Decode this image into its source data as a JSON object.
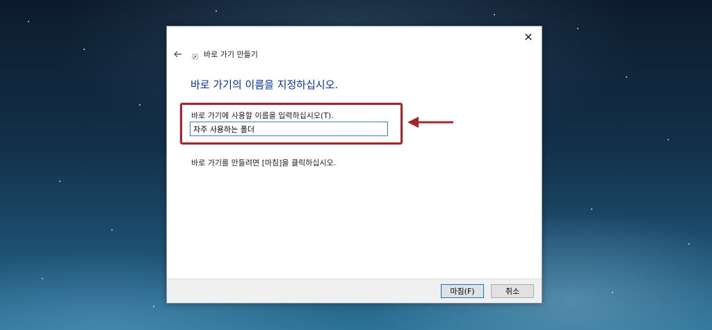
{
  "dialog": {
    "close_glyph": "✕",
    "nav_title": "바로 가기 만들기",
    "heading": "바로 가기의 이름을 지정하십시오.",
    "field_label": "바로 가기에 사용할 이름을 입력하십시오(T).",
    "name_value": "자주 사용하는 폴더",
    "instruction": "바로 가기를 만들려면 [마침]을 클릭하십시오.",
    "finish_label": "마침(F)",
    "cancel_label": "취소"
  },
  "icons": {
    "back": "back-arrow-icon",
    "close": "close-icon",
    "shortcut": "shortcut-icon",
    "annotation": "red-arrow-icon"
  },
  "colors": {
    "heading": "#003399",
    "highlight": "#a4262c",
    "input_border": "#3c7fb1",
    "finish_border": "#0078d7"
  }
}
